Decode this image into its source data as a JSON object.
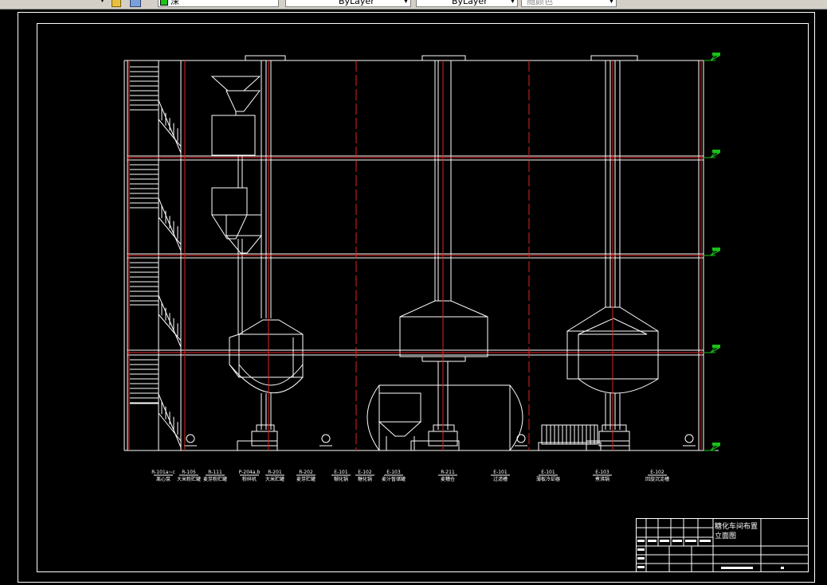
{
  "toolbar": {
    "layer_name": "深",
    "color": "ByLayer",
    "linetype": "ByLayer",
    "lineweight": "随颜色",
    "layer_color": "#19c119"
  },
  "drawing": {
    "background": "#000000",
    "equipment_labels": [
      {
        "tag": "R-101a~c",
        "name": "离心泵"
      },
      {
        "tag": "R-105",
        "name": "大米粉贮罐"
      },
      {
        "tag": "R-111",
        "name": "麦芽粉贮罐"
      },
      {
        "tag": "P-204a,b",
        "name": "粉碎机"
      },
      {
        "tag": "R-201",
        "name": "大米贮罐"
      },
      {
        "tag": "R-202",
        "name": "麦芽贮罐"
      },
      {
        "tag": "E-101",
        "name": "糊化锅"
      },
      {
        "tag": "E-102",
        "name": "糖化锅"
      },
      {
        "tag": "E-103",
        "name": "麦汁暂储罐"
      },
      {
        "tag": "R-211",
        "name": "麦糟仓"
      },
      {
        "tag": "E-101",
        "name": "过滤槽"
      },
      {
        "tag": "E-101",
        "name": "薄板冷却器"
      },
      {
        "tag": "E-103",
        "name": "煮沸锅"
      },
      {
        "tag": "E-102",
        "name": "回旋沉淀槽"
      }
    ],
    "title_block": {
      "title_line1": "糖化车间布置",
      "title_line2": "立面图"
    }
  }
}
